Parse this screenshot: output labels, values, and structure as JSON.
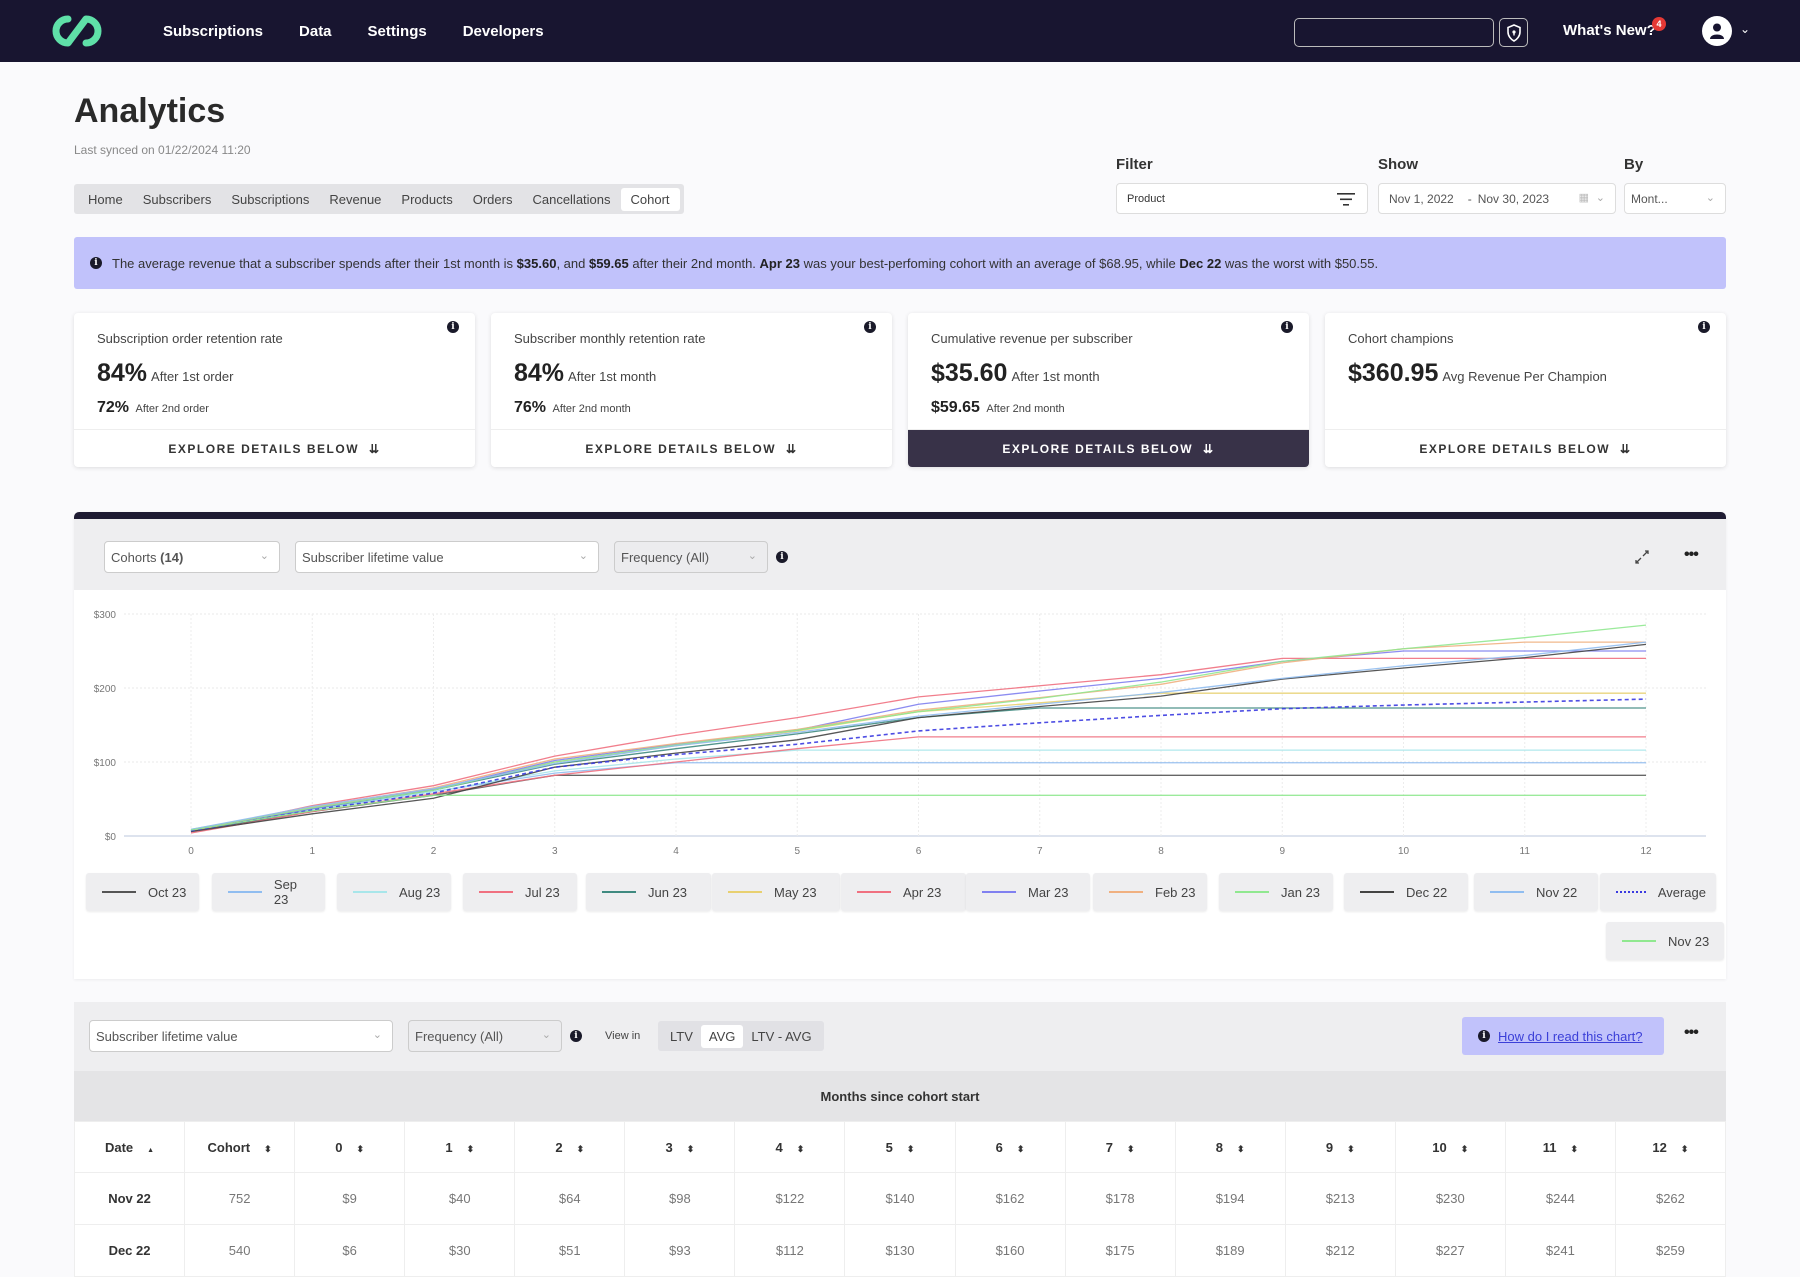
{
  "nav": {
    "links": [
      "Subscriptions",
      "Data",
      "Settings",
      "Developers"
    ],
    "whats_new": "What's New?",
    "notification_count": "4",
    "search_value": ""
  },
  "header": {
    "title": "Analytics",
    "synced": "Last synced on 01/22/2024 11:20"
  },
  "tabs": [
    "Home",
    "Subscribers",
    "Subscriptions",
    "Revenue",
    "Products",
    "Orders",
    "Cancellations",
    "Cohort"
  ],
  "active_tab": "Cohort",
  "filters": {
    "filter_label": "Filter",
    "filter_value": "Product",
    "show_label": "Show",
    "date_start": "Nov 1, 2022",
    "date_sep": "-",
    "date_end": "Nov 30, 2023",
    "by_label": "By",
    "by_value": "Mont..."
  },
  "banner": {
    "p1": "The average revenue that a subscriber spends after their 1st month is ",
    "v1": "$35.60",
    "p2": ", and ",
    "v2": "$59.65",
    "p3": " after their 2nd month. ",
    "best": "Apr 23",
    "p4": " was your best-perfoming cohort with an average of $68.95, while ",
    "worst": "Dec 22",
    "p5": " was the worst with $50.55."
  },
  "cards": [
    {
      "title": "Subscription order retention rate",
      "big": "84%",
      "big_label": "After 1st order",
      "second": "72%",
      "second_label": "After 2nd order",
      "explore": "EXPLORE DETAILS BELOW",
      "active": false
    },
    {
      "title": "Subscriber monthly retention rate",
      "big": "84%",
      "big_label": "After 1st month",
      "second": "76%",
      "second_label": "After 2nd month",
      "explore": "EXPLORE DETAILS BELOW",
      "active": false
    },
    {
      "title": "Cumulative revenue per subscriber",
      "big": "$35.60",
      "big_label": "After 1st month",
      "second": "$59.65",
      "second_label": "After 2nd month",
      "explore": "EXPLORE DETAILS BELOW",
      "active": true
    },
    {
      "title": "Cohort champions",
      "big": "$360.95",
      "big_label": "Avg Revenue Per Champion",
      "second": "",
      "second_label": "",
      "explore": "EXPLORE DETAILS BELOW",
      "active": false
    }
  ],
  "chart_toolbar": {
    "cohorts_label": "Cohorts",
    "cohorts_count": "(14)",
    "metric": "Subscriber lifetime value",
    "frequency": "Frequency (All)"
  },
  "chart_data": {
    "type": "line",
    "title": "",
    "xlabel": "",
    "ylabel": "",
    "x": [
      0,
      1,
      2,
      3,
      4,
      5,
      6,
      7,
      8,
      9,
      10,
      11,
      12
    ],
    "ylim": [
      0,
      300
    ],
    "yticks": [
      "$0",
      "$100",
      "$200",
      "$300"
    ],
    "grid": true,
    "legend_position": "bottom",
    "series": [
      {
        "name": "Oct 23",
        "color": "#555555",
        "dashed": false,
        "values": [
          7,
          33,
          55,
          82,
          82,
          82,
          82,
          82,
          82,
          82,
          82,
          82,
          82
        ]
      },
      {
        "name": "Sep 23",
        "color": "#90bdf0",
        "dashed": false,
        "values": [
          8,
          35,
          60,
          85,
          99,
          99,
          99,
          99,
          99,
          99,
          99,
          99,
          99
        ]
      },
      {
        "name": "Aug 23",
        "color": "#a8e6ea",
        "dashed": false,
        "values": [
          8,
          36,
          60,
          88,
          104,
          116,
          116,
          116,
          116,
          116,
          116,
          116,
          116
        ]
      },
      {
        "name": "Jul 23",
        "color": "#f07080",
        "dashed": false,
        "values": [
          4,
          33,
          57,
          82,
          100,
          118,
          134,
          134,
          134,
          134,
          134,
          134,
          134
        ]
      },
      {
        "name": "Jun 23",
        "color": "#3f8a80",
        "dashed": false,
        "values": [
          8,
          37,
          62,
          97,
          118,
          138,
          160,
          173,
          173,
          173,
          173,
          173,
          173
        ]
      },
      {
        "name": "May 23",
        "color": "#e8d070",
        "dashed": false,
        "values": [
          8,
          38,
          63,
          100,
          122,
          142,
          168,
          180,
          193,
          193,
          193,
          193,
          193
        ]
      },
      {
        "name": "Apr 23",
        "color": "#f07080",
        "dashed": false,
        "values": [
          6,
          41,
          68,
          108,
          136,
          160,
          188,
          203,
          218,
          240,
          240,
          240,
          240
        ]
      },
      {
        "name": "Mar 23",
        "color": "#8080f0",
        "dashed": false,
        "values": [
          8,
          37,
          63,
          102,
          124,
          143,
          178,
          196,
          213,
          236,
          250,
          250,
          250
        ]
      },
      {
        "name": "Feb 23",
        "color": "#f0b080",
        "dashed": false,
        "values": [
          8,
          39,
          65,
          104,
          125,
          144,
          170,
          187,
          205,
          234,
          253,
          262,
          262
        ]
      },
      {
        "name": "Jan 23",
        "color": "#90e890",
        "dashed": false,
        "values": [
          9,
          38,
          62,
          100,
          123,
          143,
          168,
          186,
          208,
          236,
          253,
          268,
          285
        ]
      },
      {
        "name": "Dec 22",
        "color": "#444444",
        "dashed": false,
        "values": [
          6,
          30,
          51,
          93,
          112,
          130,
          160,
          175,
          189,
          212,
          227,
          241,
          259
        ]
      },
      {
        "name": "Nov 22",
        "color": "#90bdf0",
        "dashed": false,
        "values": [
          9,
          40,
          64,
          98,
          122,
          140,
          162,
          178,
          194,
          213,
          230,
          244,
          262
        ]
      },
      {
        "name": "Average",
        "color": "#3a3ae0",
        "dashed": true,
        "values": [
          7,
          35,
          58,
          93,
          110,
          124,
          142,
          153,
          163,
          172,
          177,
          181,
          185
        ]
      },
      {
        "name": "Nov 23",
        "color": "#90e890",
        "dashed": false,
        "values": [
          8,
          34,
          55,
          55,
          55,
          55,
          55,
          55,
          55,
          55,
          55,
          55,
          55
        ]
      }
    ]
  },
  "table_toolbar": {
    "metric": "Subscriber lifetime value",
    "frequency": "Frequency (All)",
    "view_in": "View in",
    "view_options": [
      "LTV",
      "AVG",
      "LTV - AVG"
    ],
    "view_active": "AVG",
    "help_link": "How do I read this chart?"
  },
  "table": {
    "group_header": "Months since cohort start",
    "columns": [
      "Date",
      "Cohort",
      "0",
      "1",
      "2",
      "3",
      "4",
      "5",
      "6",
      "7",
      "8",
      "9",
      "10",
      "11",
      "12"
    ],
    "rows": [
      [
        "Nov 22",
        "752",
        "$9",
        "$40",
        "$64",
        "$98",
        "$122",
        "$140",
        "$162",
        "$178",
        "$194",
        "$213",
        "$230",
        "$244",
        "$262"
      ],
      [
        "Dec 22",
        "540",
        "$6",
        "$30",
        "$51",
        "$93",
        "$112",
        "$130",
        "$160",
        "$175",
        "$189",
        "$212",
        "$227",
        "$241",
        "$259"
      ]
    ]
  }
}
